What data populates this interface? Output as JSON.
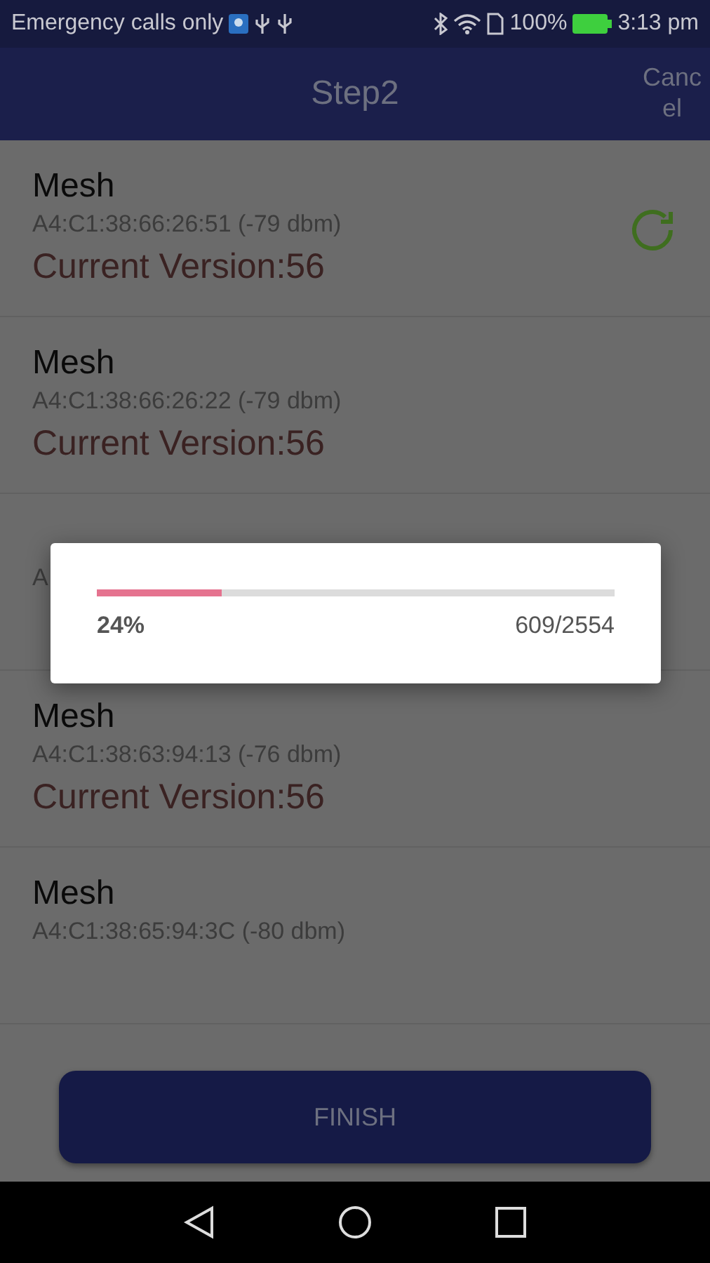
{
  "status_bar": {
    "carrier": "Emergency calls only",
    "battery": "100%",
    "time": "3:13 pm"
  },
  "app_bar": {
    "title": "Step2",
    "action": "Canc\nel"
  },
  "devices": [
    {
      "name": "Mesh",
      "address": "A4:C1:38:66:26:51 (-79 dbm)",
      "version": "Current Version:56",
      "refreshing": true
    },
    {
      "name": "Mesh",
      "address": "A4:C1:38:66:26:22 (-79 dbm)",
      "version": "Current Version:56",
      "refreshing": false
    },
    {
      "address": "A",
      "refreshing": false
    },
    {
      "name": "Mesh",
      "address": "A4:C1:38:63:94:13 (-76 dbm)",
      "version": "Current Version:56",
      "refreshing": false
    },
    {
      "name": "Mesh",
      "address": "A4:C1:38:65:94:3C (-80 dbm)",
      "refreshing": false
    }
  ],
  "finish_button": "FINISH",
  "progress_dialog": {
    "level": 0.24,
    "percent": "24%",
    "count": "609/2554"
  }
}
